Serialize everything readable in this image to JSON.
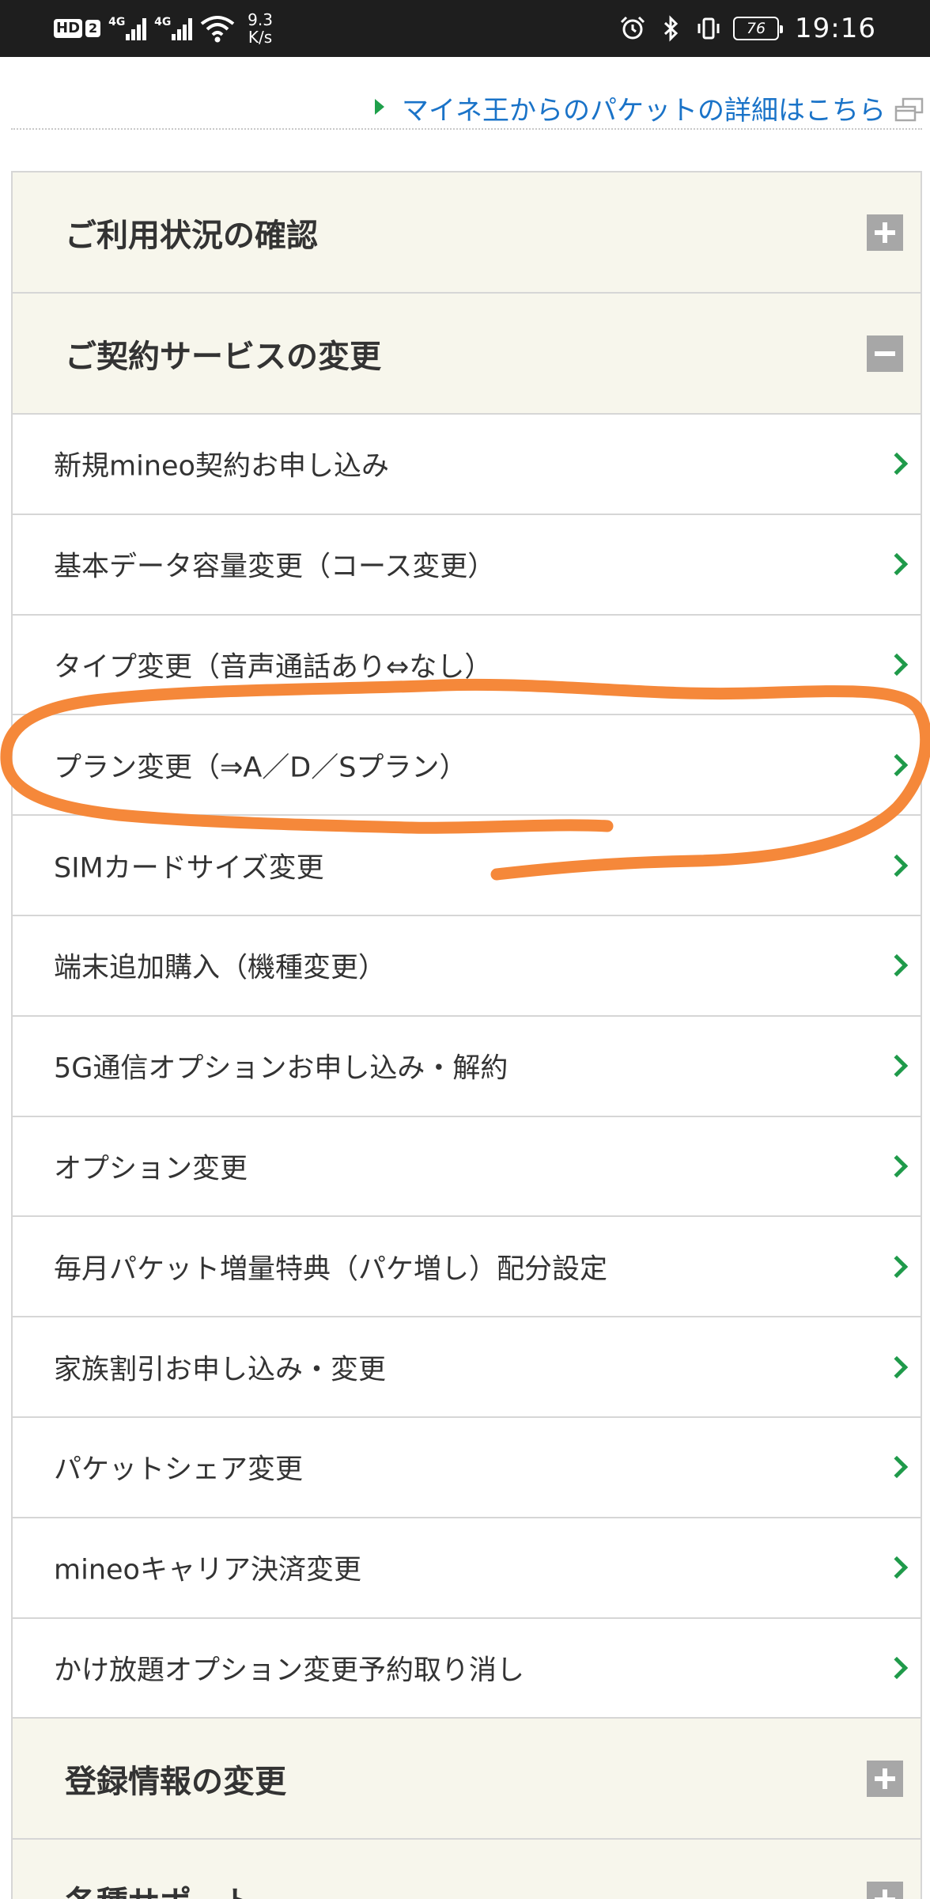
{
  "status_bar": {
    "hd": "HD",
    "sim": "2",
    "net1": "4G",
    "net2": "4G",
    "speed_value": "9.3",
    "speed_unit": "K/s",
    "battery": "76",
    "time": "19:16",
    "icons": [
      "alarm-icon",
      "bluetooth-icon",
      "vibrate-icon"
    ]
  },
  "packet_link": {
    "label": "マイネ王からのパケットの詳細はこちら",
    "icon": "external-window-icon"
  },
  "sections": [
    {
      "title": "ご利用状況の確認",
      "state": "collapsed"
    },
    {
      "title": "ご契約サービスの変更",
      "state": "expanded"
    },
    {
      "title": "登録情報の変更",
      "state": "collapsed"
    },
    {
      "title": "各種サポート",
      "state": "collapsed"
    }
  ],
  "contract_items": [
    "新規mineo契約お申し込み",
    "基本データ容量変更（コース変更）",
    "タイプ変更（音声通話あり⇔なし）",
    "プラン変更（⇒A／D／Sプラン）",
    "SIMカードサイズ変更",
    "端末追加購入（機種変更）",
    "5G通信オプションお申し込み・解約",
    "オプション変更",
    "毎月パケット増量特典（パケ増し）配分設定",
    "家族割引お申し込み・変更",
    "パケットシェア変更",
    "mineoキャリア決済変更",
    "かけ放題オプション変更予約取り消し"
  ],
  "colors": {
    "section_bg": "#f7f6ec",
    "chevron": "#1f9a4a",
    "link": "#1a73c8",
    "annotation": "#f5883a"
  }
}
